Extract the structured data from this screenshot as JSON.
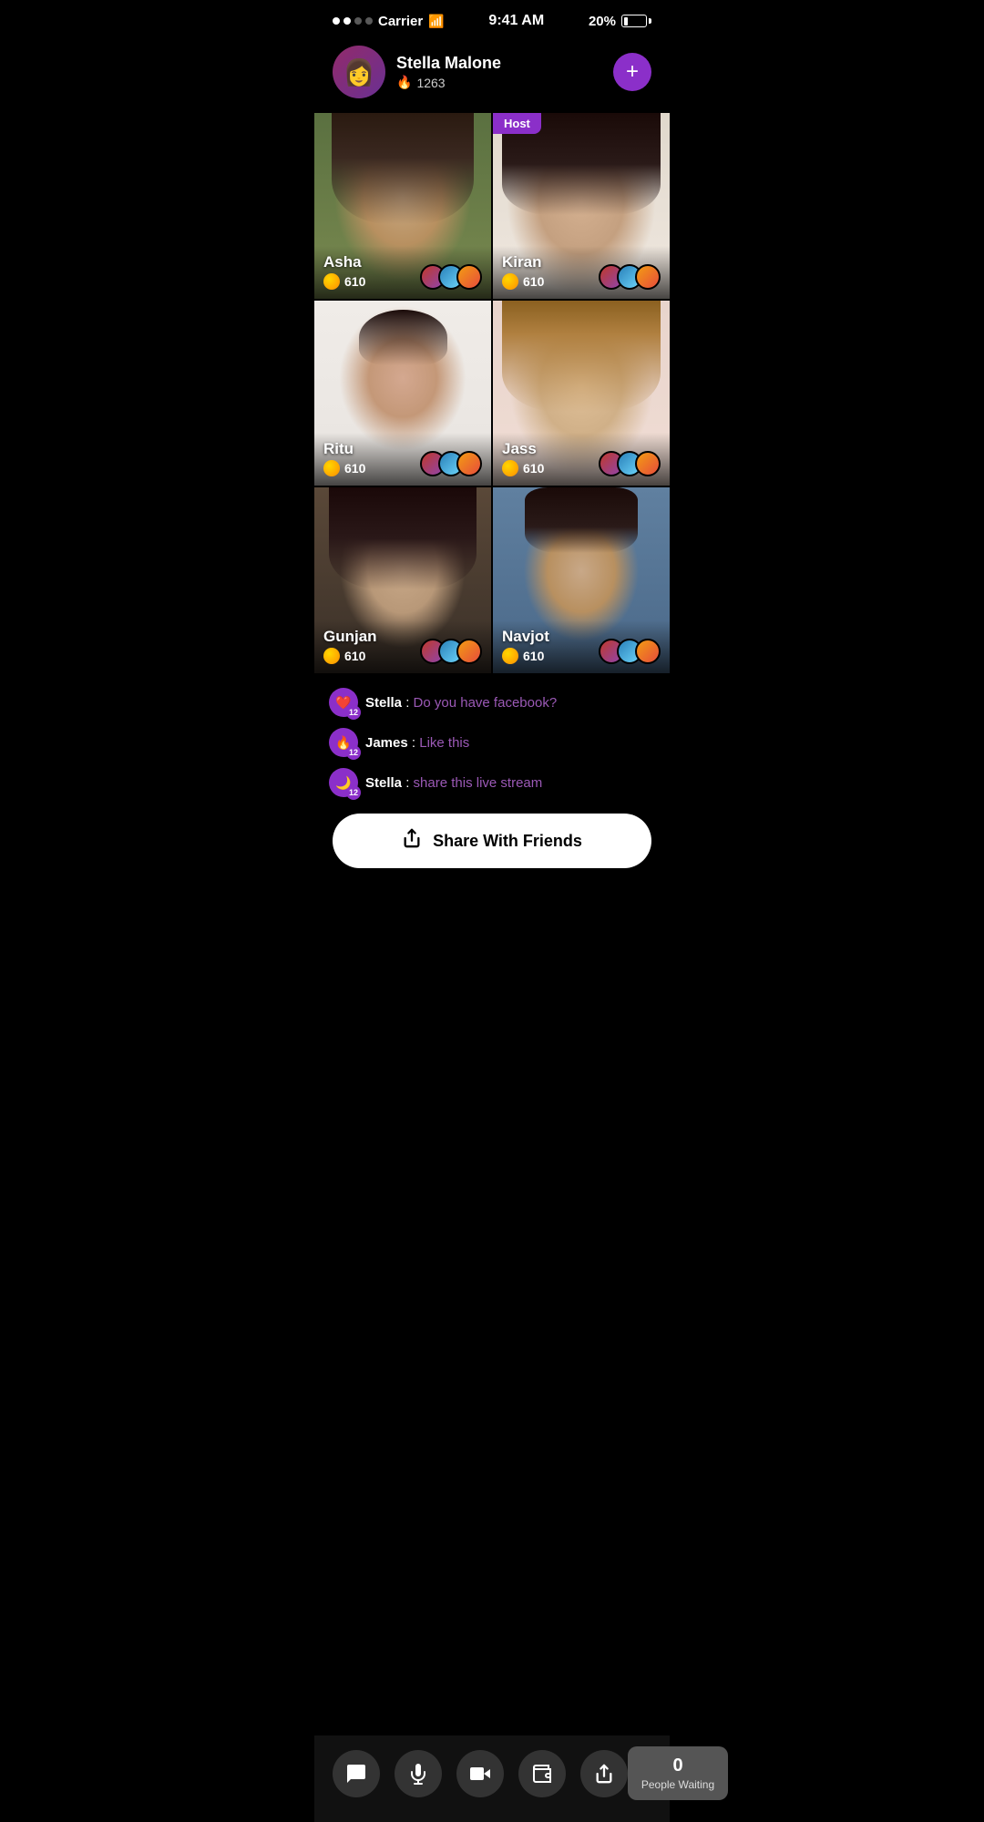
{
  "status_bar": {
    "carrier": "Carrier",
    "time": "9:41 AM",
    "battery_percent": "20%"
  },
  "profile": {
    "name": "Stella Malone",
    "score": "1263",
    "plus_label": "+"
  },
  "grid": {
    "cells": [
      {
        "id": "asha",
        "name": "Asha",
        "coins": "610",
        "is_host": false
      },
      {
        "id": "kiran",
        "name": "Kiran",
        "coins": "610",
        "is_host": true
      },
      {
        "id": "ritu",
        "name": "Ritu",
        "coins": "610",
        "is_host": false
      },
      {
        "id": "jass",
        "name": "Jass",
        "coins": "610",
        "is_host": false
      },
      {
        "id": "gunjan",
        "name": "Gunjan",
        "coins": "610",
        "is_host": false
      },
      {
        "id": "navjot",
        "name": "Navjot",
        "coins": "610",
        "is_host": false
      }
    ],
    "host_label": "Host"
  },
  "chat": {
    "messages": [
      {
        "user": "Stella",
        "icon": "❤️",
        "badge": "12",
        "content": "Do you have facebook?"
      },
      {
        "user": "James",
        "icon": "🔥",
        "badge": "12",
        "content": "Like this"
      },
      {
        "user": "Stella",
        "icon": "🌙",
        "badge": "12",
        "content": "share this live stream"
      }
    ]
  },
  "share": {
    "button_label": "Share With Friends"
  },
  "bottom_bar": {
    "people_count": "0",
    "people_label": "People Waiting"
  }
}
